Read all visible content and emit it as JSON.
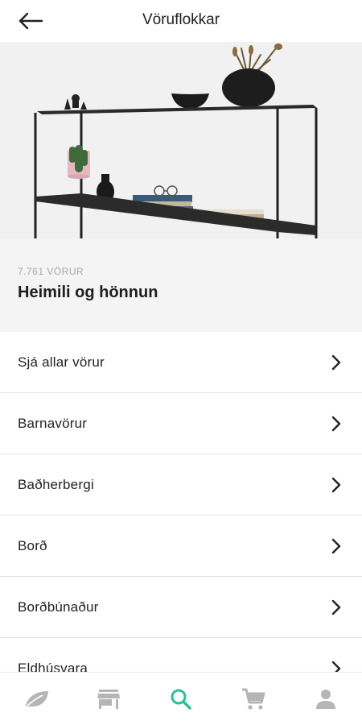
{
  "header": {
    "title": "Vöruflokkar",
    "back_icon": "arrow-left-icon"
  },
  "category": {
    "count_label": "7.761 VÖRUR",
    "name": "Heimili og hönnun"
  },
  "list": {
    "items": [
      {
        "label": "Sjá allar vörur",
        "icon": "chevron-right-icon"
      },
      {
        "label": "Barnavörur",
        "icon": "chevron-right-icon"
      },
      {
        "label": "Baðherbergi",
        "icon": "chevron-right-icon"
      },
      {
        "label": "Borð",
        "icon": "chevron-right-icon"
      },
      {
        "label": "Borðbúnaður",
        "icon": "chevron-right-icon"
      },
      {
        "label": "Eldhúsvara",
        "icon": "chevron-right-icon"
      }
    ]
  },
  "bottom_nav": {
    "items": [
      {
        "icon": "leaf-icon",
        "active": false
      },
      {
        "icon": "store-icon",
        "active": false
      },
      {
        "icon": "search-icon",
        "active": true
      },
      {
        "icon": "cart-icon",
        "active": false
      },
      {
        "icon": "profile-icon",
        "active": false
      }
    ],
    "active_color": "#2bbf95",
    "inactive_color": "#b5b5b5"
  }
}
